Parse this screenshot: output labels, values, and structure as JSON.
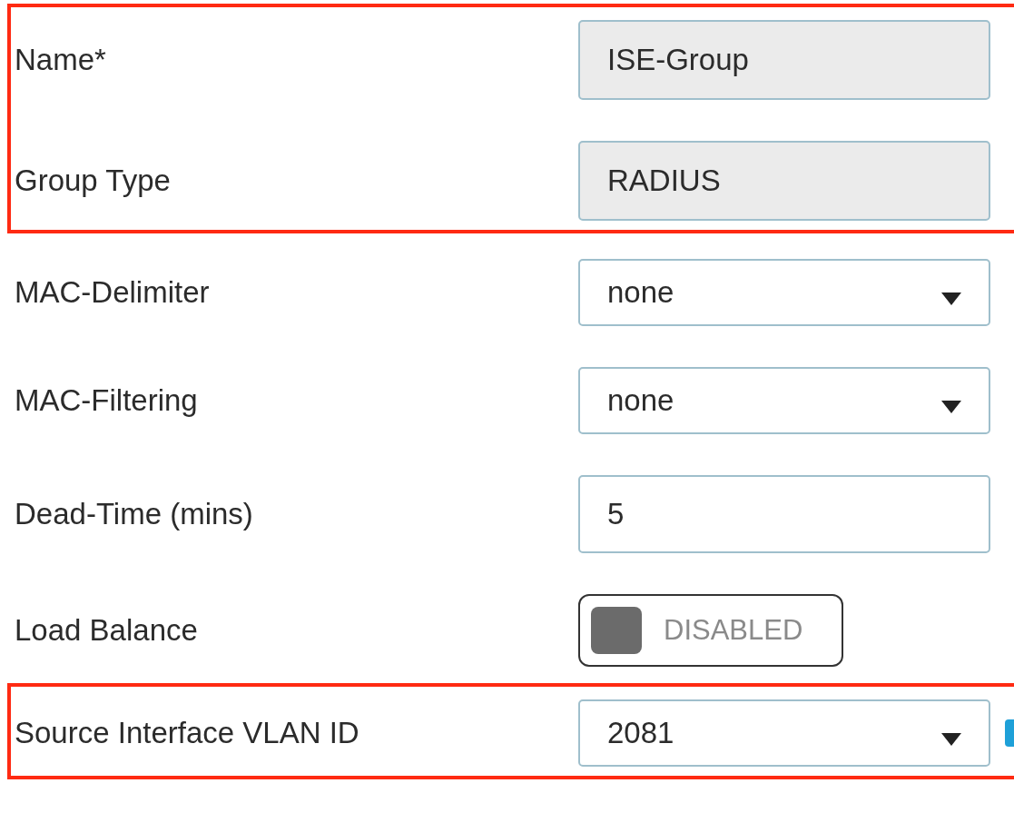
{
  "sections": [
    {
      "highlighted": true,
      "rows": [
        {
          "kind": "readonly",
          "label": "Name*",
          "value": "ISE-Group"
        },
        {
          "kind": "readonly",
          "label": "Group Type",
          "value": "RADIUS"
        }
      ]
    },
    {
      "highlighted": false,
      "rows": [
        {
          "kind": "select",
          "label": "MAC-Delimiter",
          "value": "none"
        },
        {
          "kind": "select",
          "label": "MAC-Filtering",
          "value": "none"
        },
        {
          "kind": "input",
          "label": "Dead-Time (mins)",
          "value": "5"
        },
        {
          "kind": "toggle",
          "label": "Load Balance",
          "on": false,
          "value": "DISABLED"
        }
      ]
    },
    {
      "highlighted": true,
      "rows": [
        {
          "kind": "select",
          "label": "Source Interface VLAN ID",
          "value": "2081",
          "trailing_icon": true
        }
      ]
    }
  ]
}
